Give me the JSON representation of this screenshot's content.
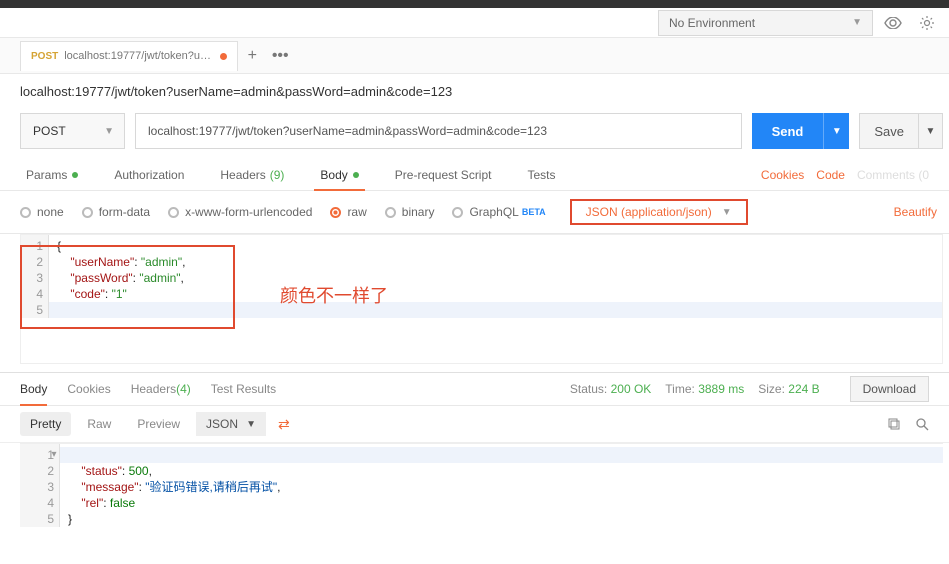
{
  "env": {
    "placeholder": "No Environment"
  },
  "tab": {
    "method": "POST",
    "title": "localhost:19777/jwt/token?use..."
  },
  "urlline": "localhost:19777/jwt/token?userName=admin&passWord=admin&code=123",
  "method": "POST",
  "url": "localhost:19777/jwt/token?userName=admin&passWord=admin&code=123",
  "send": "Send",
  "save": "Save",
  "subtabs": {
    "params": "Params",
    "auth": "Authorization",
    "headers": "Headers",
    "headers_n": "(9)",
    "body": "Body",
    "prereq": "Pre-request Script",
    "tests": "Tests",
    "cookies": "Cookies",
    "code": "Code",
    "comments": "Comments (0"
  },
  "bodytype": {
    "none": "none",
    "formdata": "form-data",
    "xwww": "x-www-form-urlencoded",
    "raw": "raw",
    "binary": "binary",
    "graphql": "GraphQL",
    "beta": "BETA",
    "ctype": "JSON (application/json)",
    "beautify": "Beautify"
  },
  "reqbody": {
    "l1": "{",
    "k1": "\"userName\"",
    "v1": "\"admin\"",
    "k2": "\"passWord\"",
    "v2": "\"admin\"",
    "k3": "\"code\"",
    "v3": "\"1\"",
    "l5": "}"
  },
  "annotation": "颜色不一样了",
  "resp_meta": {
    "status_lbl": "Status:",
    "status": "200 OK",
    "time_lbl": "Time:",
    "time": "3889 ms",
    "size_lbl": "Size:",
    "size": "224 B",
    "download": "Download"
  },
  "resptabs": {
    "body": "Body",
    "cookies": "Cookies",
    "headers": "Headers",
    "headers_n": "(4)",
    "tests": "Test Results"
  },
  "respopt": {
    "pretty": "Pretty",
    "raw": "Raw",
    "preview": "Preview",
    "fmt": "JSON"
  },
  "respbody": {
    "l1": "{",
    "k1": "\"status\"",
    "v1": "500",
    "k2": "\"message\"",
    "v2": "\"验证码错误,请稍后再试\"",
    "k3": "\"rel\"",
    "v3": "false",
    "l5": "}"
  }
}
